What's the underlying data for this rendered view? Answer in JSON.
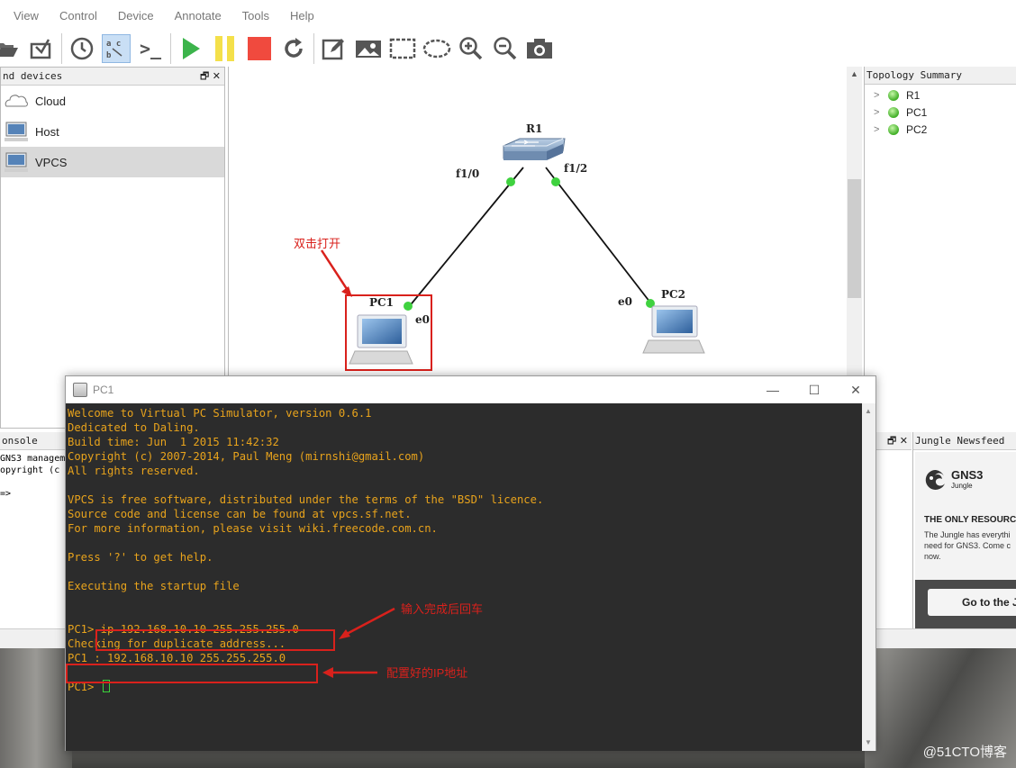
{
  "menu": [
    "View",
    "Control",
    "Device",
    "Annotate",
    "Tools",
    "Help"
  ],
  "toolbar": {
    "console_label": ">_"
  },
  "devices_panel": {
    "title": "nd devices",
    "controls": "🗗 ✕",
    "items": [
      {
        "label": "Cloud"
      },
      {
        "label": "Host"
      },
      {
        "label": "VPCS"
      }
    ]
  },
  "canvas": {
    "router": {
      "name": "R1",
      "port_left": "f1/0",
      "port_right": "f1/2"
    },
    "pc1": {
      "name": "PC1",
      "port": "e0"
    },
    "pc2": {
      "name": "PC2",
      "port": "e0"
    },
    "annotation": "双击打开"
  },
  "topology_summary": {
    "title": "Topology Summary",
    "items": [
      "R1",
      "PC1",
      "PC2"
    ]
  },
  "console_dock": {
    "title": "onsole",
    "lines": [
      "GNS3 manageme",
      "opyright (c",
      "",
      "=>"
    ]
  },
  "mid_dock_controls": "🗗 ✕",
  "jungle": {
    "title": "Jungle Newsfeed",
    "logo_name": "GNS3",
    "logo_sub": "Jungle",
    "headline": "THE ONLY RESOURC",
    "text": "The Jungle has everythi\nneed for GNS3. Come c\nnow.",
    "button": "Go to the J"
  },
  "pc_window": {
    "title": "PC1",
    "minimize": "—",
    "maximize": "☐",
    "close": "✕",
    "lines": [
      "Welcome to Virtual PC Simulator, version 0.6.1",
      "Dedicated to Daling.",
      "Build time: Jun  1 2015 11:42:32",
      "Copyright (c) 2007-2014, Paul Meng (mirnshi@gmail.com)",
      "All rights reserved.",
      "",
      "VPCS is free software, distributed under the terms of the \"BSD\" licence.",
      "Source code and license can be found at vpcs.sf.net.",
      "For more information, please visit wiki.freecode.com.cn.",
      "",
      "Press '?' to get help.",
      "",
      "Executing the startup file",
      "",
      "",
      "PC1> ip 192.168.10.10 255.255.255.0",
      "Checking for duplicate address...",
      "PC1 : 192.168.10.10 255.255.255.0",
      "",
      "PC1> "
    ],
    "note_enter": "输入完成后回车",
    "note_ip": "配置好的IP地址"
  },
  "watermark": "@51CTO博客",
  "colors": {
    "terminal_bg": "#2c2c2c",
    "terminal_text": "#e8a31c",
    "annotation_red": "#d9211c",
    "link_green": "#3fd23f"
  }
}
